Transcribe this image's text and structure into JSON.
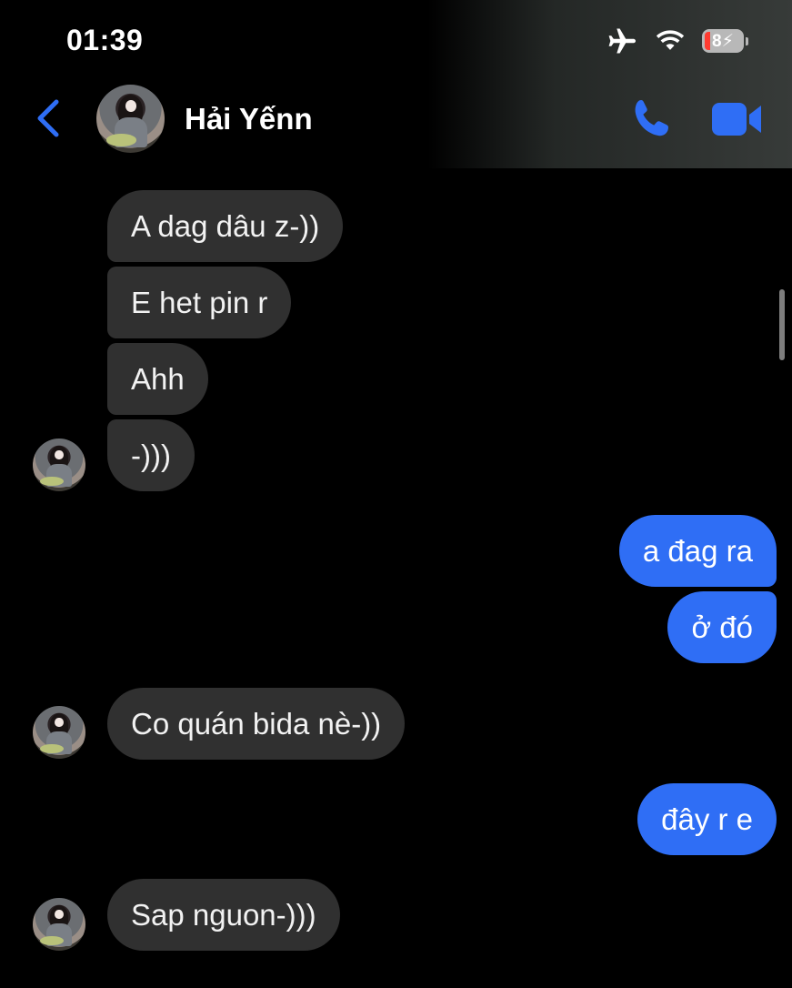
{
  "status_bar": {
    "time": "01:39",
    "battery": "8"
  },
  "header": {
    "contact_name": "Hải Yếnn"
  },
  "colors": {
    "accent": "#2f6ef5",
    "incoming_bubble": "#303030",
    "background": "#000000"
  },
  "messages": [
    {
      "side": "incoming",
      "text": "A dag dâu z-))"
    },
    {
      "side": "incoming",
      "text": "E het pin r"
    },
    {
      "side": "incoming",
      "text": "Ahh"
    },
    {
      "side": "incoming",
      "text": "-)))"
    },
    {
      "side": "outgoing",
      "text": "a đag ra"
    },
    {
      "side": "outgoing",
      "text": "ở đó"
    },
    {
      "side": "incoming",
      "text": "Co quán bida nè-))"
    },
    {
      "side": "outgoing",
      "text": "đây r e"
    },
    {
      "side": "incoming",
      "text": "Sap nguon-)))"
    }
  ]
}
